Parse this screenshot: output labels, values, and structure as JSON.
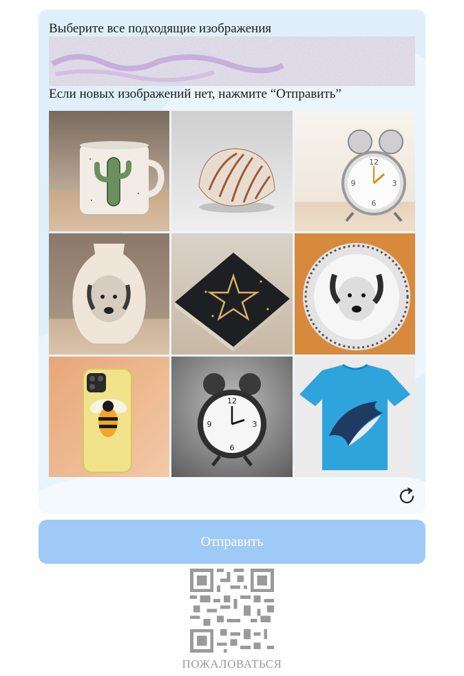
{
  "captcha": {
    "instruction": "Выберите все подходящие изображения",
    "distorted_image_alt": "distorted-target-image",
    "subinstruction": "Если новых изображений нет, нажмите “Отправить”",
    "tiles": [
      {
        "icon": "cactus-mug"
      },
      {
        "icon": "seashell"
      },
      {
        "icon": "alarm-clock-white"
      },
      {
        "icon": "dog-vase"
      },
      {
        "icon": "star-notebook"
      },
      {
        "icon": "dog-plate"
      },
      {
        "icon": "bee-phone-case"
      },
      {
        "icon": "alarm-clock-black"
      },
      {
        "icon": "dolphin-tshirt"
      }
    ],
    "refresh_icon": "refresh-icon"
  },
  "submit": {
    "label": "Отправить"
  },
  "qr": {
    "icon": "qr-code-icon"
  },
  "report": {
    "label": "ПОЖАЛОВАТЬСЯ"
  },
  "colors": {
    "card_bg": "#dff0fb",
    "submit_bg": "#9fcaf8",
    "report_text": "#9a9a9a"
  }
}
